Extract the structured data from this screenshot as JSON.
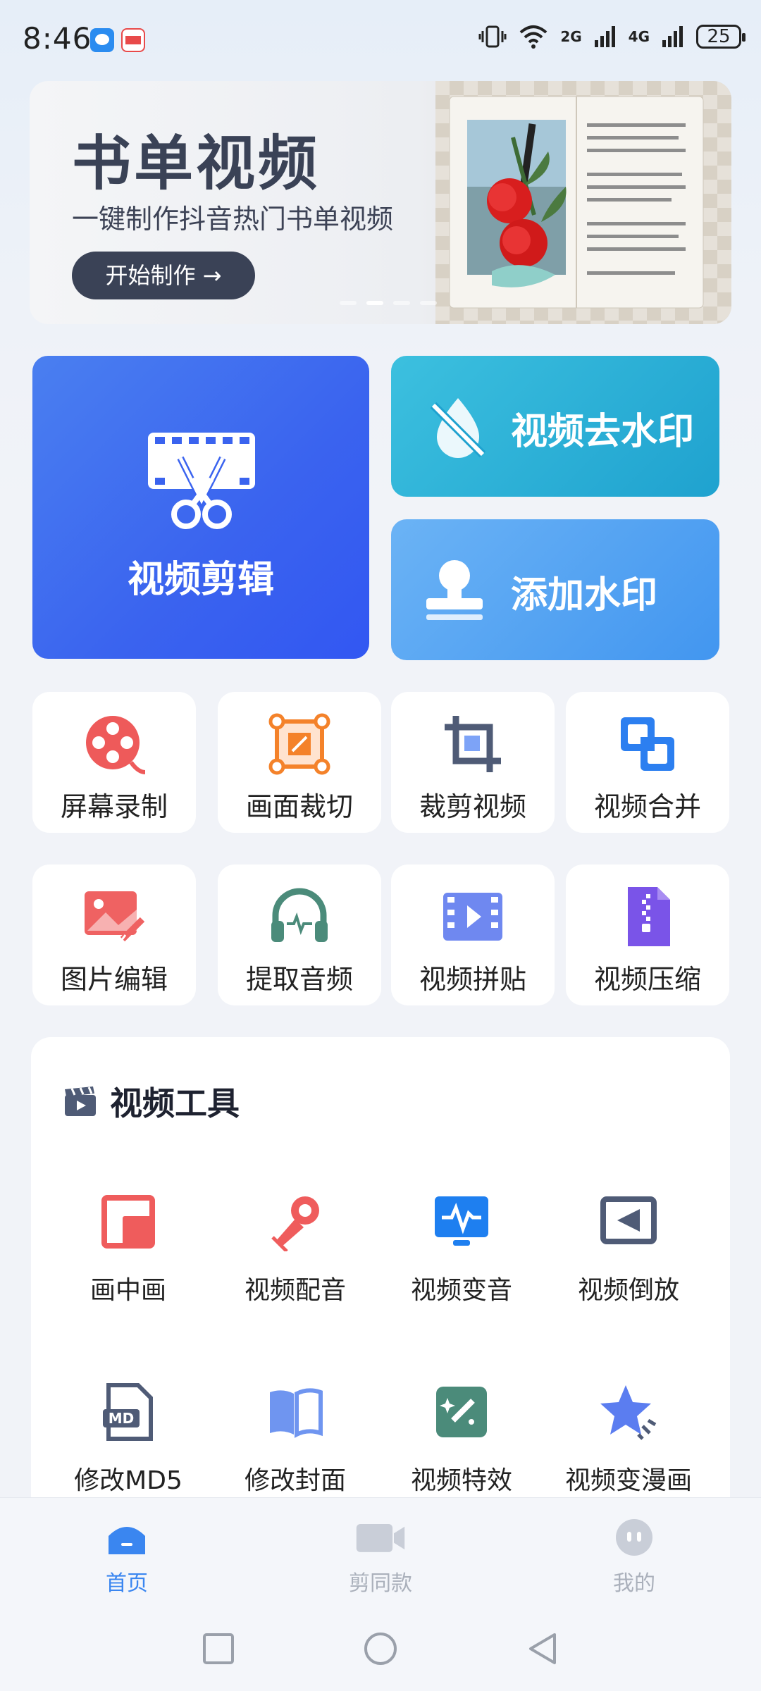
{
  "status_bar": {
    "time": "8:46",
    "network_1": "2G",
    "network_2": "4G",
    "battery": "25"
  },
  "banner": {
    "title": "书单视频",
    "subtitle": "一键制作抖音热门书单视频",
    "button_label": "开始制作  →",
    "active_slide": 2,
    "slide_count": 4
  },
  "main_cards": {
    "video_edit": "视频剪辑",
    "remove_watermark": "视频去水印",
    "add_watermark": "添加水印"
  },
  "tiles": [
    {
      "label": "屏幕录制",
      "icon": "film-reel-icon"
    },
    {
      "label": "画面裁切",
      "icon": "frame-crop-icon"
    },
    {
      "label": "裁剪视频",
      "icon": "crop-icon"
    },
    {
      "label": "视频合并",
      "icon": "merge-icon"
    },
    {
      "label": "图片编辑",
      "icon": "image-edit-icon"
    },
    {
      "label": "提取音频",
      "icon": "headphones-icon"
    },
    {
      "label": "视频拼贴",
      "icon": "video-collage-icon"
    },
    {
      "label": "视频压缩",
      "icon": "zip-file-icon"
    }
  ],
  "video_tools": {
    "title": "视频工具",
    "items": [
      {
        "label": "画中画",
        "icon": "picture-in-picture-icon"
      },
      {
        "label": "视频配音",
        "icon": "microphone-icon"
      },
      {
        "label": "视频变音",
        "icon": "voice-change-icon"
      },
      {
        "label": "视频倒放",
        "icon": "reverse-play-icon"
      },
      {
        "label": "修改MD5",
        "icon": "md5-file-icon"
      },
      {
        "label": "修改封面",
        "icon": "book-cover-icon"
      },
      {
        "label": "视频特效",
        "icon": "magic-wand-icon"
      },
      {
        "label": "视频变漫画",
        "icon": "star-comic-icon"
      }
    ]
  },
  "bottom_nav": [
    {
      "label": "首页",
      "icon": "home-icon",
      "active": true
    },
    {
      "label": "剪同款",
      "icon": "video-camera-icon",
      "active": false
    },
    {
      "label": "我的",
      "icon": "profile-icon",
      "active": false
    }
  ],
  "colors": {
    "accent": "#3a86f0",
    "edit_card": "#3a63ef",
    "watermark_card": "#1fa2cf",
    "add_watermark_card": "#4296f0"
  }
}
